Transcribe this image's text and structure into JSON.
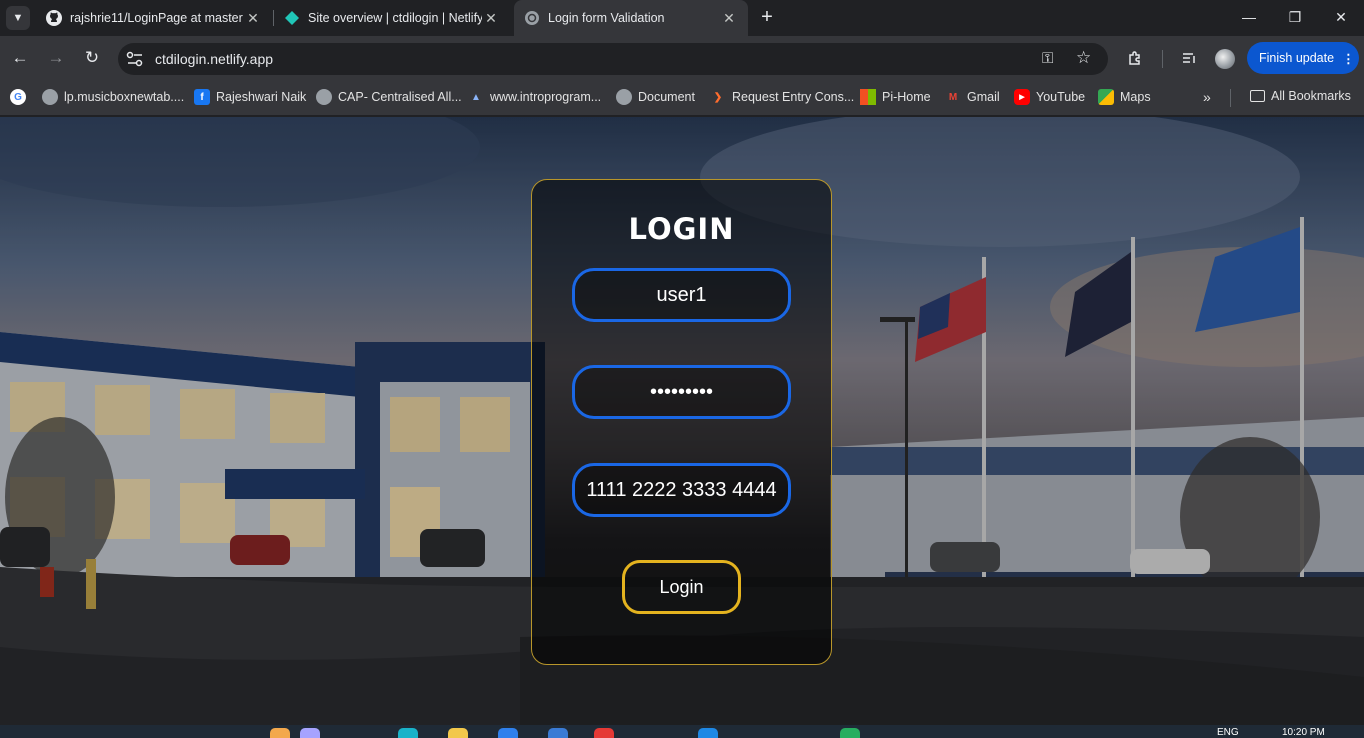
{
  "browser": {
    "tabs": [
      {
        "title": "rajshrie11/LoginPage at master",
        "icon": "github-icon",
        "active": false
      },
      {
        "title": "Site overview | ctdilogin | Netlify",
        "icon": "netlify-icon",
        "active": false
      },
      {
        "title": "Login form Validation",
        "icon": "globe-icon",
        "active": true
      }
    ],
    "url": "ctdilogin.netlify.app",
    "update_button": "Finish update",
    "bookmarks": [
      {
        "label": "lp.musicboxnewtab....",
        "icon": "globe-icon"
      },
      {
        "label": "Rajeshwari Naik",
        "icon": "facebook-icon"
      },
      {
        "label": "CAP- Centralised All...",
        "icon": "globe-icon"
      },
      {
        "label": "www.introprogram...",
        "icon": "shark-icon"
      },
      {
        "label": "Document",
        "icon": "globe-icon"
      },
      {
        "label": "Request Entry Cons...",
        "icon": "bolt-icon"
      },
      {
        "label": "Pi-Home",
        "icon": "microsoft-icon"
      },
      {
        "label": "Gmail",
        "icon": "gmail-icon"
      },
      {
        "label": "YouTube",
        "icon": "youtube-icon"
      },
      {
        "label": "Maps",
        "icon": "maps-icon"
      }
    ],
    "all_bookmarks": "All Bookmarks"
  },
  "login": {
    "title": "LOGIN",
    "username": "user1",
    "password": "•••••••••",
    "card_number": "1111 2222 3333 4444",
    "submit": "Login"
  },
  "colors": {
    "field_border": "#1a67e5",
    "button_border": "#e4b31f",
    "card_border": "#b8962a"
  },
  "taskbar": {
    "language": "ENG",
    "time": "10:20 PM"
  }
}
